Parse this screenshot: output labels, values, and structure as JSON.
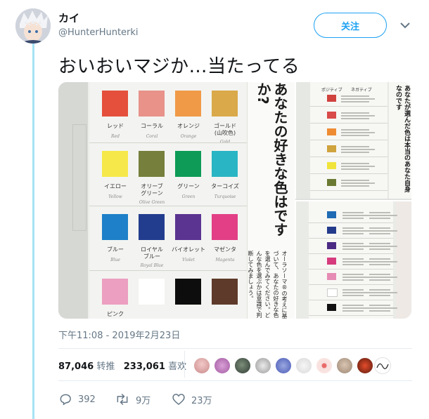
{
  "tweet": {
    "display_name": "カイ",
    "handle": "@HunterHunterki",
    "follow_label": "关注",
    "text": "おいおいマジか…当たってる",
    "timestamp": "下午11:08 - 2019年2月23日"
  },
  "stats": {
    "retweets_count": "87,046",
    "retweets_label": "转推",
    "likes_count": "233,061",
    "likes_label": "喜欢"
  },
  "actions": {
    "reply_count": "392",
    "retweet_count": "9万",
    "like_count": "23万"
  },
  "media": {
    "swatches": [
      {
        "jp": "レッド",
        "en": "Red",
        "color": "#e4503b"
      },
      {
        "jp": "コーラル",
        "en": "Coral",
        "color": "#e8928a"
      },
      {
        "jp": "オレンジ",
        "en": "Orange",
        "color": "#f09a48"
      },
      {
        "jp": "ゴールド\n(山吹色)",
        "en": "Gold",
        "color": "#d9a94a"
      },
      {
        "jp": "イエロー",
        "en": "Yellow",
        "color": "#f6e84a"
      },
      {
        "jp": "オリーブ\nグリーン",
        "en": "Olive Green",
        "color": "#767f3c"
      },
      {
        "jp": "グリーン",
        "en": "Green",
        "color": "#0e9b58"
      },
      {
        "jp": "ターコイズ",
        "en": "Turquoise",
        "color": "#2ab5c4"
      },
      {
        "jp": "ブルー",
        "en": "Blue",
        "color": "#1e80c8"
      },
      {
        "jp": "ロイヤル\nブルー",
        "en": "Royal Blue",
        "color": "#233d8e"
      },
      {
        "jp": "バイオレット",
        "en": "Violet",
        "color": "#5b3491"
      },
      {
        "jp": "マゼンタ",
        "en": "Magenta",
        "color": "#e23f86"
      },
      {
        "jp": "ピンク",
        "en": "",
        "color": "#ec9fc0"
      },
      {
        "jp": "",
        "en": "",
        "color": "#ffffff"
      },
      {
        "jp": "",
        "en": "",
        "color": "#0d0d0d"
      },
      {
        "jp": "",
        "en": "",
        "color": "#5e3a2a"
      }
    ],
    "vertical_title": "あなたの好きな色はですか?",
    "vertical_subtitle": "オーラソーマ®の考えに基づいて、あなたの好きな色を選んでみてください。どんな色を選ぶかは意識で判断してみましょう。",
    "right_title": "あなたが選んだ色は本当のあなた自身なのです",
    "right_top_header_1": "ポジティブ",
    "right_top_header_2": "ネガティブ"
  },
  "colors": {
    "accent": "#1da1f2",
    "thread_line": "#a6e3f5",
    "secondary_text": "#657786"
  }
}
